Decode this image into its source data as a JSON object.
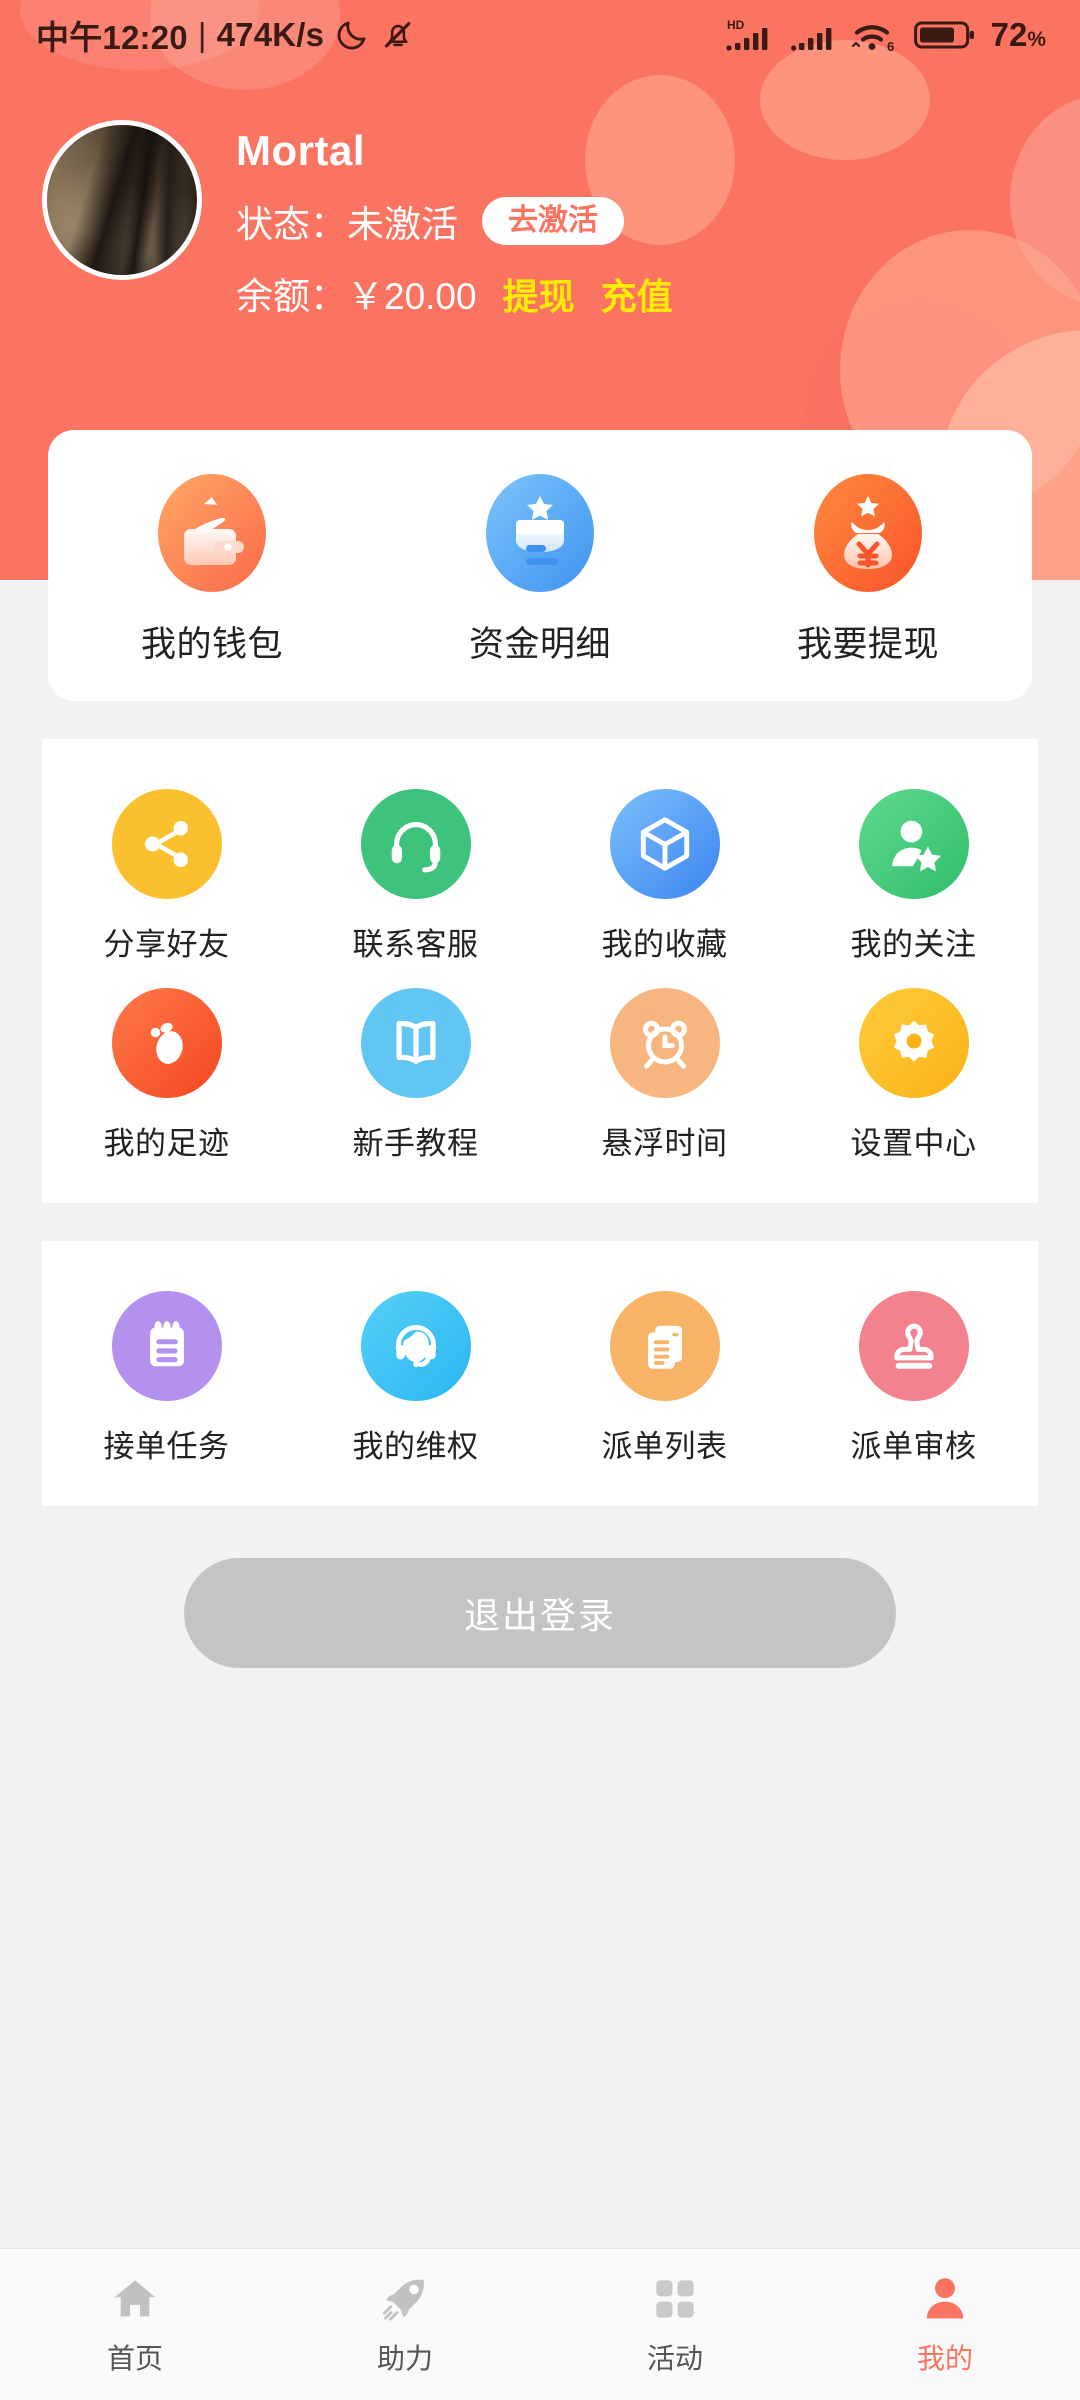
{
  "statusbar": {
    "time": "中午12:20",
    "divider": "|",
    "network_speed": "474K/s",
    "moon_icon": "moon-icon",
    "mute_icon": "bell-muted-icon",
    "hd_label": "HD",
    "signal1_icon": "cellular-signal-icon",
    "signal2_icon": "cellular-signal-icon",
    "wifi_icon": "wifi-6-icon",
    "wifi_generation": "6",
    "battery_icon": "battery-icon",
    "battery_percent": "72",
    "battery_percent_sign": "%"
  },
  "profile": {
    "avatar_name": "user-avatar",
    "username": "Mortal",
    "status_label": "状态：未激活",
    "activate_button": "去激活",
    "balance_label": "余额：￥20.00",
    "withdraw_link": "提现",
    "recharge_link": "充值"
  },
  "wallet_card": {
    "items": [
      {
        "label": "我的钱包",
        "icon": "wallet-icon"
      },
      {
        "label": "资金明细",
        "icon": "fund-details-icon"
      },
      {
        "label": "我要提现",
        "icon": "money-bag-icon"
      }
    ]
  },
  "services_card": {
    "items": [
      {
        "label": "分享好友",
        "icon": "share-icon"
      },
      {
        "label": "联系客服",
        "icon": "headset-icon"
      },
      {
        "label": "我的收藏",
        "icon": "cube-icon"
      },
      {
        "label": "我的关注",
        "icon": "person-star-icon"
      },
      {
        "label": "我的足迹",
        "icon": "footprint-icon"
      },
      {
        "label": "新手教程",
        "icon": "book-icon"
      },
      {
        "label": "悬浮时间",
        "icon": "alarm-clock-icon"
      },
      {
        "label": "设置中心",
        "icon": "gear-icon"
      }
    ]
  },
  "orders_card": {
    "items": [
      {
        "label": "接单任务",
        "icon": "notepad-icon"
      },
      {
        "label": "我的维权",
        "icon": "support-agent-icon"
      },
      {
        "label": "派单列表",
        "icon": "documents-icon"
      },
      {
        "label": "派单审核",
        "icon": "stamp-icon"
      }
    ]
  },
  "logout": {
    "label": "退出登录"
  },
  "bottomnav": {
    "items": [
      {
        "label": "首页",
        "icon": "home-icon",
        "active": false
      },
      {
        "label": "助力",
        "icon": "rocket-icon",
        "active": false
      },
      {
        "label": "活动",
        "icon": "grid-icon",
        "active": false
      },
      {
        "label": "我的",
        "icon": "person-icon",
        "active": true
      }
    ]
  },
  "colors": {
    "header_bg": "#fb7462",
    "accent": "#fb7462",
    "money_link": "#ffec00",
    "logout_bg": "#c4c4c4",
    "page_bg": "#f2f2f2"
  }
}
